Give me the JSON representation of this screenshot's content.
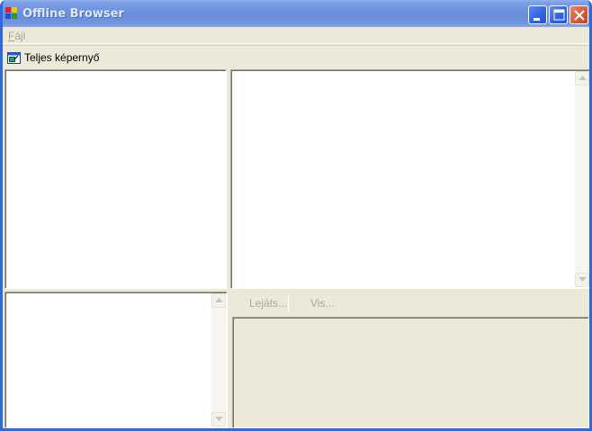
{
  "window": {
    "title": "Offline Browser",
    "icon": "app-window-icon",
    "controls": [
      "minimize-icon",
      "maximize-icon",
      "close-icon"
    ]
  },
  "menu": {
    "items": [
      {
        "prefix": "F",
        "rest": "ájl"
      }
    ]
  },
  "toolbar": {
    "fullscreen_label": "Teljes képernyő",
    "fullscreen_icon": "fullscreen-icon"
  },
  "media_toolbar": {
    "play_label": "Lejáts...",
    "back_label": "Vis..."
  },
  "colors": {
    "face": "#ece9d8",
    "titlebar": "#6a8ddc",
    "frame": "#3169d6",
    "disabled_text": "#aca899"
  }
}
